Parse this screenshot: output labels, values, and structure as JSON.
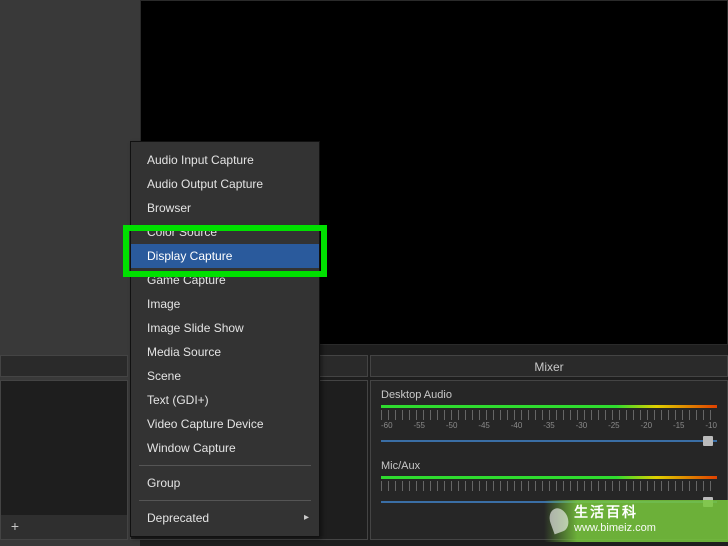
{
  "panels": {
    "sources_header": "",
    "mixer_header": "Mixer"
  },
  "context_menu": {
    "items": [
      {
        "label": "Audio Input Capture"
      },
      {
        "label": "Audio Output Capture"
      },
      {
        "label": "Browser"
      },
      {
        "label": "Color Source"
      },
      {
        "label": "Display Capture",
        "highlighted": true
      },
      {
        "label": "Game Capture"
      },
      {
        "label": "Image"
      },
      {
        "label": "Image Slide Show"
      },
      {
        "label": "Media Source"
      },
      {
        "label": "Scene"
      },
      {
        "label": "Text (GDI+)"
      },
      {
        "label": "Video Capture Device"
      },
      {
        "label": "Window Capture"
      }
    ],
    "group_label": "Group",
    "deprecated_label": "Deprecated"
  },
  "sources_footer": {
    "add_symbol": "+"
  },
  "mixer": {
    "ticks": [
      "-60",
      "-55",
      "-50",
      "-45",
      "-40",
      "-35",
      "-30",
      "-25",
      "-20",
      "-15",
      "-10"
    ],
    "channels": [
      {
        "name": "Desktop Audio"
      },
      {
        "name": "Mic/Aux"
      }
    ]
  },
  "watermark": {
    "cn": "生活百科",
    "url": "www.bimeiz.com"
  }
}
